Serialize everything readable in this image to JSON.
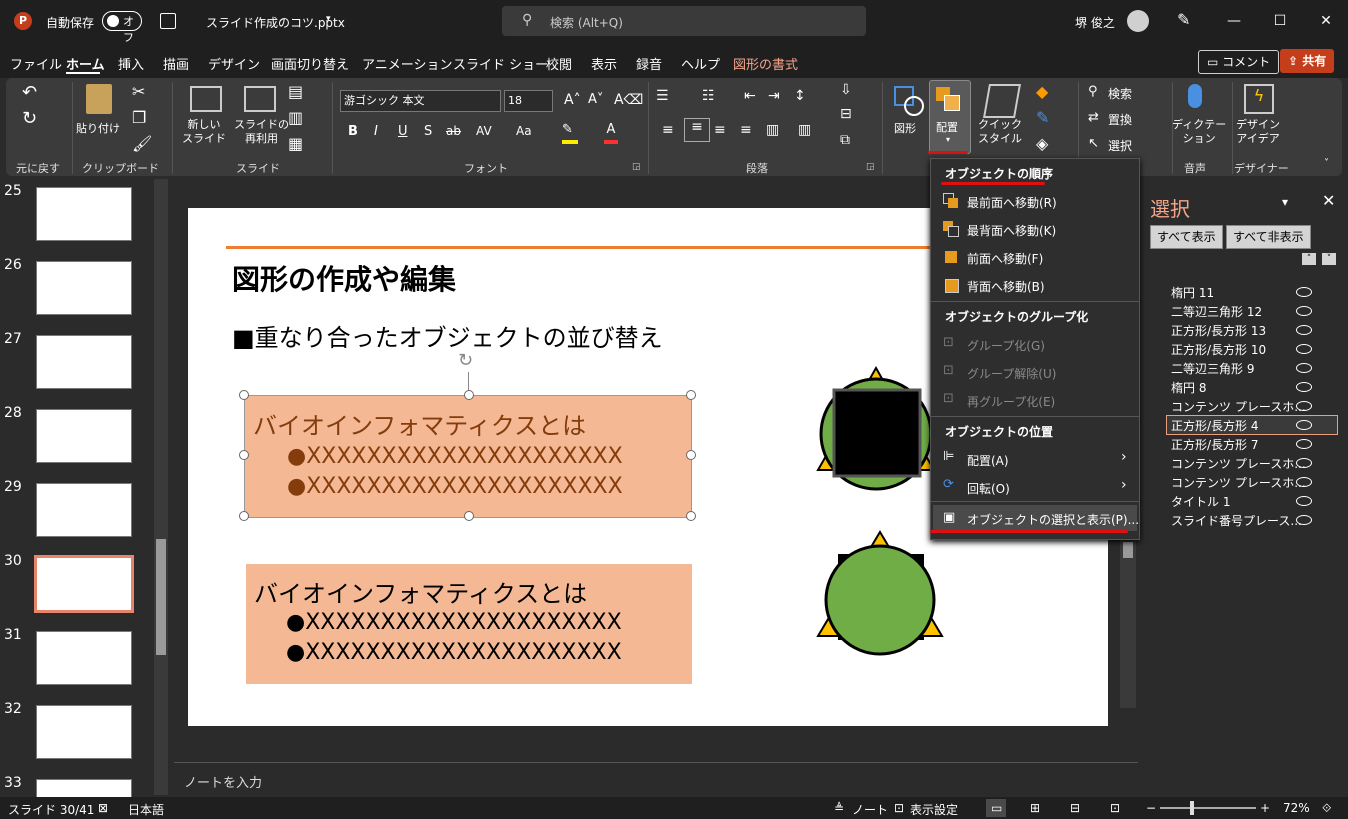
{
  "titlebar": {
    "autosave_label": "自動保存",
    "autosave_state": "オフ",
    "filename": "スライド作成のコツ.pptx",
    "search_placeholder": "検索 (Alt+Q)",
    "user_name": "堺 俊之",
    "min": "—",
    "max": "☐",
    "close": "✕"
  },
  "menu": {
    "items": [
      "ファイル",
      "ホーム",
      "挿入",
      "描画",
      "デザイン",
      "画面切り替え",
      "アニメーション",
      "スライド ショー",
      "校閲",
      "表示",
      "録音",
      "ヘルプ",
      "図形の書式"
    ],
    "comment_label": "コメント",
    "share_label": "共有"
  },
  "ribbon": {
    "undo_group": "元に戻す",
    "clipboard_group": "クリップボード",
    "paste_label": "貼り付け",
    "slide_group": "スライド",
    "new_slide": "新しい\nスライド",
    "reuse_slide": "スライドの\n再利用",
    "font_group": "フォント",
    "font_name": "游ゴシック 本文",
    "font_size": "18",
    "paragraph_group": "段落",
    "shapes_label": "図形",
    "arrange_label": "配置",
    "quick_style_label": "クイック\nスタイル",
    "editing": {
      "find": "検索",
      "replace": "置換",
      "select": "選択"
    },
    "voice_group": "音声",
    "dictate_label": "ディクテー\nション",
    "designer_group": "デザイナー",
    "design_ideas_label": "デザイン\nアイデア",
    "font_buttons": [
      "B",
      "I",
      "U",
      "S",
      "ab",
      "AV",
      "Aa"
    ]
  },
  "slides_panel": {
    "numbers": [
      "25",
      "26",
      "27",
      "28",
      "29",
      "30",
      "31",
      "32",
      "33"
    ],
    "selected": "30"
  },
  "slide": {
    "title": "図形の作成や編集",
    "subtitle": "■重なり合ったオブジェクトの並び替え",
    "box1_title": "バイオインフォマティクスとは",
    "box1_line1": "●XXXXXXXXXXXXXXXXXXXXX",
    "box1_line2": "●XXXXXXXXXXXXXXXXXXXXX",
    "box2_title": "バイオインフォマティクスとは",
    "box2_line1": "●XXXXXXXXXXXXXXXXXXXXX",
    "box2_line2": "●XXXXXXXXXXXXXXXXXXXXX"
  },
  "dropdown": {
    "order_header": "オブジェクトの順序",
    "bring_front": "最前面へ移動(R)",
    "send_back": "最背面へ移動(K)",
    "bring_forward": "前面へ移動(F)",
    "send_backward": "背面へ移動(B)",
    "group_header": "オブジェクトのグループ化",
    "group": "グループ化(G)",
    "ungroup": "グループ解除(U)",
    "regroup": "再グループ化(E)",
    "position_header": "オブジェクトの位置",
    "align": "配置(A)",
    "rotate": "回転(O)",
    "selection_pane": "オブジェクトの選択と表示(P)..."
  },
  "selection_pane": {
    "title": "選択",
    "show_all": "すべて表示",
    "hide_all": "すべて非表示",
    "items": [
      "楕円 11",
      "二等辺三角形 12",
      "正方形/長方形 13",
      "正方形/長方形 10",
      "二等辺三角形 9",
      "楕円 8",
      "コンテンツ プレースホ...",
      "正方形/長方形 4",
      "正方形/長方形 7",
      "コンテンツ プレースホ...",
      "コンテンツ プレースホ...",
      "タイトル 1",
      "スライド番号プレース..."
    ],
    "selected_index": 7
  },
  "notes_placeholder": "ノートを入力",
  "status": {
    "slide_info": "スライド 30/41",
    "language": "日本語",
    "notes": "ノート",
    "display_settings": "表示設定",
    "zoom": "72%"
  },
  "colors": {
    "accent_orange": "#ed7d31",
    "box_fill": "#f4b994",
    "green": "#70ad47",
    "triangle": "#ffc000",
    "share": "#c43e1c",
    "highlight_red": "#e01010"
  }
}
